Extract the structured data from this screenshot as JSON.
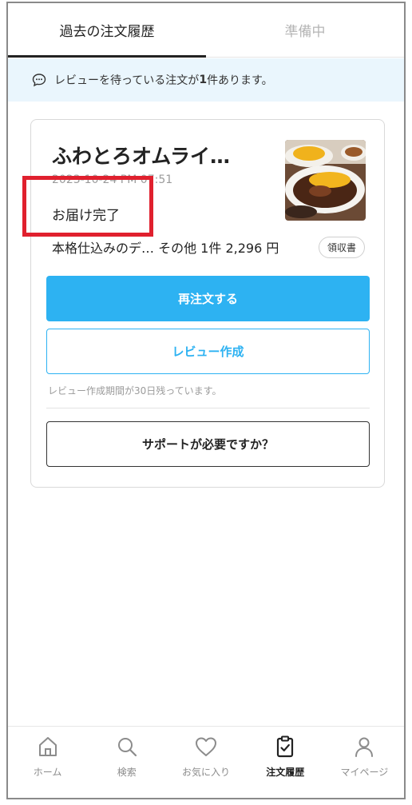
{
  "tabs": [
    {
      "label": "過去の注文履歴",
      "active": true
    },
    {
      "label": "準備中",
      "active": false
    }
  ],
  "banner": {
    "icon": "chat-bubble-icon",
    "text_before": "レビューを待っている注文が",
    "count": "1",
    "text_after": "件あります。"
  },
  "order": {
    "shop_name": "ふわとろオムライ…",
    "date": "2023-10-24 PM 07:51",
    "status": "お届け完了",
    "summary": "本格仕込みのデ…  その他 1件 2,296 円",
    "receipt_label": "領収書",
    "reorder_label": "再注文する",
    "review_label": "レビュー作成",
    "review_note": "レビュー作成期間が30日残っています。",
    "support_label": "サポートが必要ですか？"
  },
  "colors": {
    "accent": "#2db2f2",
    "banner_bg": "#eaf6fd",
    "highlight": "#e0202e"
  },
  "nav": [
    {
      "label": "ホーム",
      "icon": "home-icon",
      "active": false
    },
    {
      "label": "検索",
      "icon": "search-icon",
      "active": false
    },
    {
      "label": "お気に入り",
      "icon": "heart-icon",
      "active": false
    },
    {
      "label": "注文履歴",
      "icon": "clipboard-check-icon",
      "active": true
    },
    {
      "label": "マイページ",
      "icon": "user-icon",
      "active": false
    }
  ]
}
